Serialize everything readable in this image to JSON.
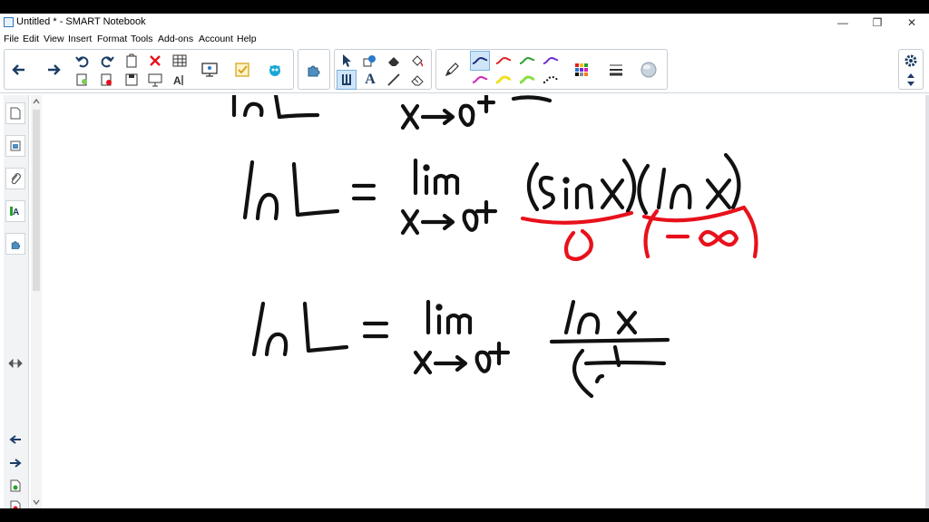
{
  "window": {
    "title": "Untitled * - SMART Notebook",
    "controls": {
      "minimize": "—",
      "restore": "❐",
      "close": "✕"
    }
  },
  "menu": {
    "items": [
      "File",
      "Edit",
      "View",
      "Insert",
      "Format",
      "Tools",
      "Add-ons",
      "Account",
      "Help"
    ]
  },
  "toolbar": {
    "text_tool_glyph": "A"
  },
  "colors": {
    "ink_black": "#111111",
    "ink_red": "#e8111b",
    "accent_blue": "#2b79c9",
    "pen_blue": "#1b2a7a",
    "pen_red": "#e02020",
    "pen_green": "#2aa02a",
    "pen_purple": "#6b2bd0",
    "pen_magenta": "#d020b0",
    "pen_yellow": "#f0e020",
    "pen_lightgreen": "#88dd44"
  }
}
